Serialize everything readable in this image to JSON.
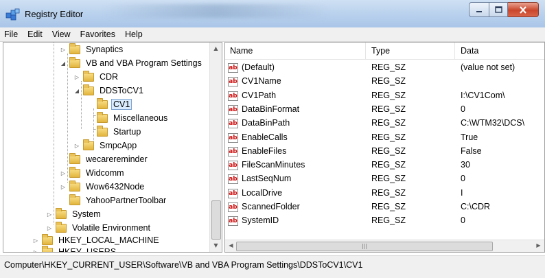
{
  "window": {
    "title": "Registry Editor"
  },
  "menu": [
    "File",
    "Edit",
    "View",
    "Favorites",
    "Help"
  ],
  "tree": [
    {
      "label": "Synaptics",
      "expander": "collapsed"
    },
    {
      "label": "VB and VBA Program Settings",
      "expander": "expanded"
    },
    {
      "label": "CDR",
      "expander": "collapsed"
    },
    {
      "label": "DDSToCV1",
      "expander": "expanded"
    },
    {
      "label": "CV1",
      "expander": "none",
      "selected": true
    },
    {
      "label": "Miscellaneous",
      "expander": "none"
    },
    {
      "label": "Startup",
      "expander": "none"
    },
    {
      "label": "SmpcApp",
      "expander": "collapsed"
    },
    {
      "label": "wecarereminder",
      "expander": "none"
    },
    {
      "label": "Widcomm",
      "expander": "collapsed"
    },
    {
      "label": "Wow6432Node",
      "expander": "collapsed"
    },
    {
      "label": "YahooPartnerToolbar",
      "expander": "none"
    },
    {
      "label": "System",
      "expander": "collapsed"
    },
    {
      "label": "Volatile Environment",
      "expander": "collapsed"
    },
    {
      "label": "HKEY_LOCAL_MACHINE",
      "expander": "collapsed"
    },
    {
      "label": "HKEY_USERS",
      "expander": "collapsed"
    }
  ],
  "values": {
    "columns": [
      "Name",
      "Type",
      "Data"
    ],
    "rows": [
      {
        "name": "(Default)",
        "type": "REG_SZ",
        "data": "(value not set)"
      },
      {
        "name": "CV1Name",
        "type": "REG_SZ",
        "data": ""
      },
      {
        "name": "CV1Path",
        "type": "REG_SZ",
        "data": "I:\\CV1Com\\"
      },
      {
        "name": "DataBinFormat",
        "type": "REG_SZ",
        "data": "0"
      },
      {
        "name": "DataBinPath",
        "type": "REG_SZ",
        "data": "C:\\WTM32\\DCS\\"
      },
      {
        "name": "EnableCalls",
        "type": "REG_SZ",
        "data": "True"
      },
      {
        "name": "EnableFiles",
        "type": "REG_SZ",
        "data": "False"
      },
      {
        "name": "FileScanMinutes",
        "type": "REG_SZ",
        "data": "30"
      },
      {
        "name": "LastSeqNum",
        "type": "REG_SZ",
        "data": "0"
      },
      {
        "name": "LocalDrive",
        "type": "REG_SZ",
        "data": "I"
      },
      {
        "name": "ScannedFolder",
        "type": "REG_SZ",
        "data": "C:\\CDR"
      },
      {
        "name": "SystemID",
        "type": "REG_SZ",
        "data": "0"
      }
    ]
  },
  "status": {
    "path": "Computer\\HKEY_CURRENT_USER\\Software\\VB and VBA Program Settings\\DDSToCV1\\CV1"
  },
  "icons": {
    "app": "registry-icon",
    "value": "string-value-icon",
    "folder": "folder-icon"
  },
  "colors": {
    "selection": "#d9ebfc",
    "close_button": "#c9462c",
    "title_gradient_top": "#cfe0f3"
  }
}
